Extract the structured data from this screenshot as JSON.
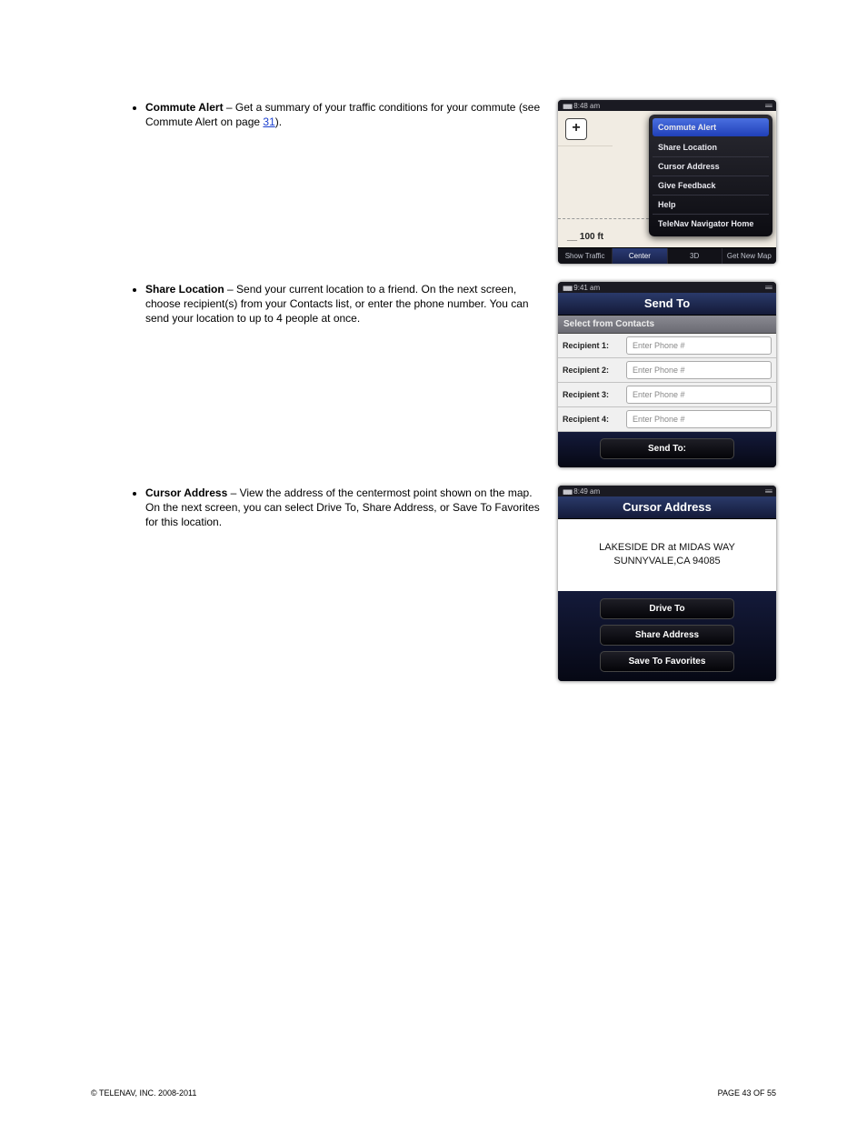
{
  "bullets": {
    "commute": {
      "title": "Commute Alert",
      "body_before": " – Get a summary of your traffic conditions for your commute (see Commute Alert on page ",
      "link": "31",
      "body_after": ")."
    },
    "share": {
      "title": "Share Location",
      "body": " – Send your current location to a friend. On the next screen, choose recipient(s) from your Contacts list, or enter the phone number. You can send your location to up to 4 people at once."
    },
    "cursor": {
      "title": "Cursor Address",
      "body": " – View the address of the centermost point shown on the map. On the next screen, you can select Drive To, Share Address, or Save To Favorites for this location."
    }
  },
  "footer": {
    "copyright": "© TELENAV, INC. 2008-2011",
    "pagenum": "PAGE 43 OF 55"
  },
  "phones": {
    "map": {
      "time": "8:48 am",
      "menu": [
        "Commute Alert",
        "Share Location",
        "Cursor Address",
        "Give Feedback",
        "Help",
        "TeleNav Navigator Home"
      ],
      "scale": "100 ft",
      "tabs": [
        "Show Traffic",
        "Center",
        "3D",
        "Get New Map"
      ]
    },
    "sendto": {
      "time": "9:41 am",
      "title": "Send To",
      "select": "Select from Contacts",
      "recipients": [
        {
          "label": "Recipient 1:",
          "ph": "Enter Phone #"
        },
        {
          "label": "Recipient 2:",
          "ph": "Enter Phone #"
        },
        {
          "label": "Recipient 3:",
          "ph": "Enter Phone #"
        },
        {
          "label": "Recipient 4:",
          "ph": "Enter Phone #"
        }
      ],
      "button": "Send To:"
    },
    "cursor": {
      "time": "8:49 am",
      "title": "Cursor Address",
      "addr1": "LAKESIDE DR at MIDAS WAY",
      "addr2": "SUNNYVALE,CA 94085",
      "buttons": [
        "Drive To",
        "Share Address",
        "Save To Favorites"
      ]
    }
  }
}
